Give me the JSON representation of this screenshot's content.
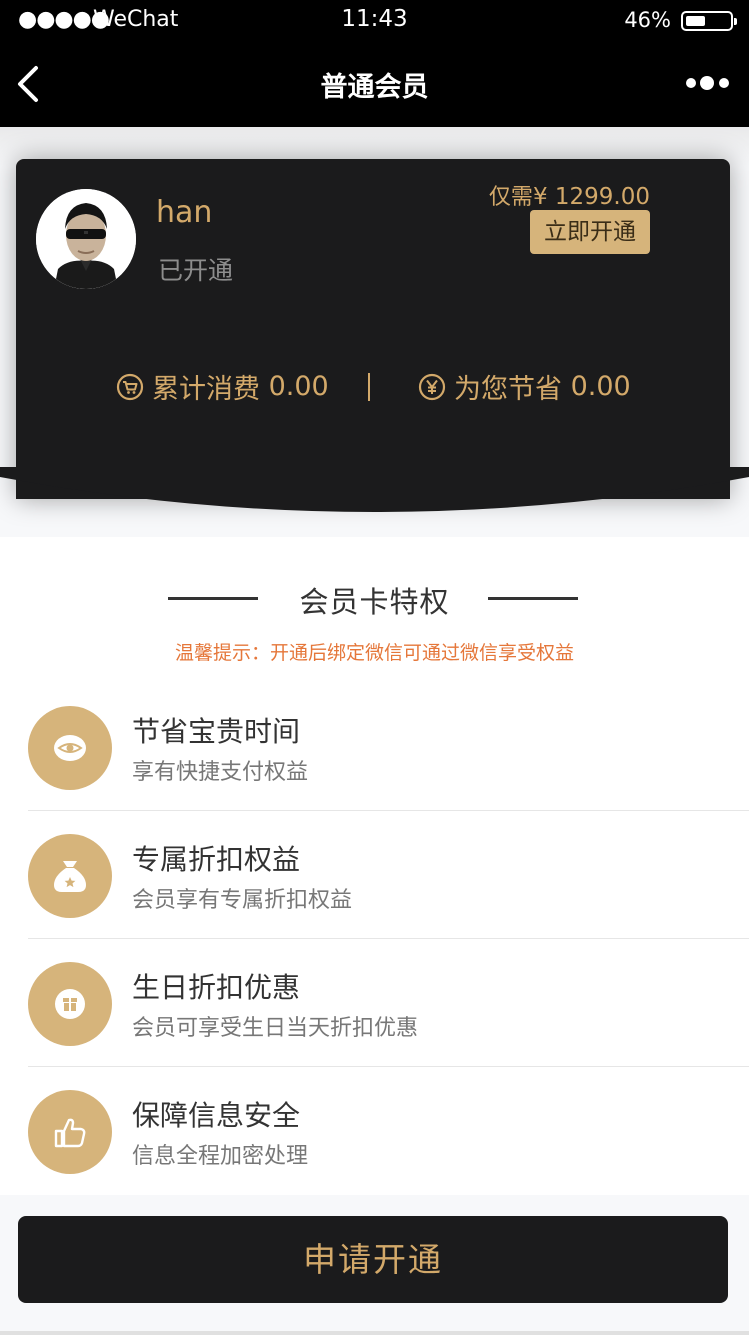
{
  "status_bar": {
    "signal": "●●●●●",
    "carrier": "WeChat",
    "time": "11:43",
    "battery": "46%",
    "battery_level": 0.46
  },
  "nav": {
    "title": "普通会员"
  },
  "card": {
    "username": "han",
    "status": "已开通",
    "price_prefix": "仅需",
    "price": "¥ 1299.00",
    "open_button": "立即开通",
    "total_spent_label": "累计消费",
    "total_spent_value": "0.00",
    "saved_label": "为您节省",
    "saved_value": "0.00"
  },
  "privileges": {
    "title": "会员卡特权",
    "tip": "温馨提示：开通后绑定微信可通过微信享受权益",
    "items": [
      {
        "name": "节省宝贵时间",
        "desc": "享有快捷支付权益",
        "icon": "eye-icon"
      },
      {
        "name": "专属折扣权益",
        "desc": "会员享有专属折扣权益",
        "icon": "money-bag-icon"
      },
      {
        "name": "生日折扣优惠",
        "desc": "会员可享受生日当天折扣优惠",
        "icon": "gift-icon"
      },
      {
        "name": "保障信息安全",
        "desc": "信息全程加密处理",
        "icon": "thumbs-up-icon"
      }
    ]
  },
  "apply_button": "申请开通",
  "colors": {
    "gold": "#d3a96a",
    "gold_button": "#d6b47b",
    "card_bg": "#1b1b1c",
    "tip": "#e5773a"
  }
}
